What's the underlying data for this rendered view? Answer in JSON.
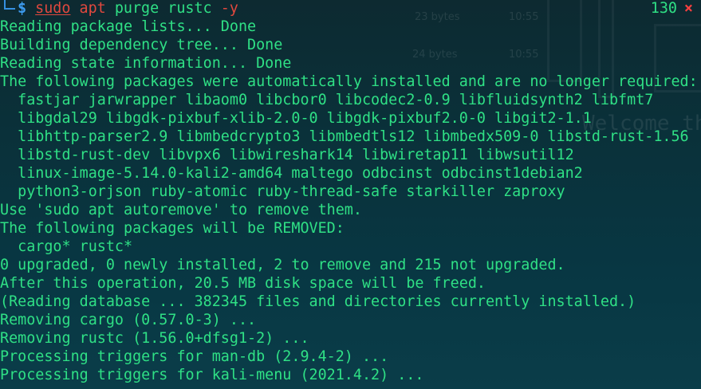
{
  "background_ghost": {
    "size_1": "23 bytes",
    "time_1": "10:55",
    "size_2": "24 bytes",
    "time_2": "10:55",
    "welcome": "Welcome the"
  },
  "prompt": {
    "symbol": "$",
    "command": {
      "sudo": "sudo",
      "apt": "apt",
      "args": "purge rustc",
      "flag": "-y"
    },
    "exit_code": "130",
    "error_mark": "×"
  },
  "output_lines": [
    "Reading package lists... Done",
    "Building dependency tree... Done",
    "Reading state information... Done",
    "The following packages were automatically installed and are no longer required:",
    "  fastjar jarwrapper libaom0 libcbor0 libcodec2-0.9 libfluidsynth2 libfmt7",
    "  libgdal29 libgdk-pixbuf-xlib-2.0-0 libgdk-pixbuf2.0-0 libgit2-1.1",
    "  libhttp-parser2.9 libmbedcrypto3 libmbedtls12 libmbedx509-0 libstd-rust-1.56",
    "  libstd-rust-dev libvpx6 libwireshark14 libwiretap11 libwsutil12",
    "  linux-image-5.14.0-kali2-amd64 maltego odbcinst odbcinst1debian2",
    "  python3-orjson ruby-atomic ruby-thread-safe starkiller zaproxy",
    "Use 'sudo apt autoremove' to remove them.",
    "The following packages will be REMOVED:",
    "  cargo* rustc*",
    "0 upgraded, 0 newly installed, 2 to remove and 215 not upgraded.",
    "After this operation, 20.5 MB disk space will be freed.",
    "(Reading database ... 382345 files and directories currently installed.)",
    "Removing cargo (0.57.0-3) ...",
    "Removing rustc (1.56.0+dfsg1-2) ...",
    "Processing triggers for man-db (2.9.4-2) ...",
    "Processing triggers for kali-menu (2021.4.2) ..."
  ],
  "colors": {
    "output_green": "#2fe085",
    "command_red": "#e0483e",
    "prompt_blue": "#3d9cf0",
    "error_red": "#ff4040"
  }
}
